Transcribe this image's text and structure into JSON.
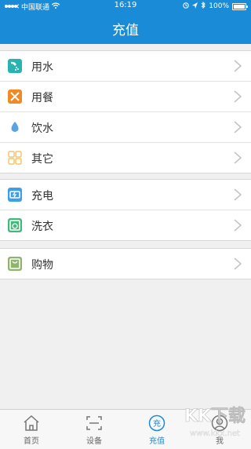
{
  "status": {
    "carrier": "中国联通",
    "time": "16:19",
    "battery": "100%"
  },
  "header": {
    "title": "充值"
  },
  "sections": [
    [
      {
        "label": "用水",
        "icon": "shower-icon",
        "color": "#27b3b0"
      },
      {
        "label": "用餐",
        "icon": "utensils-icon",
        "color": "#f08a24"
      },
      {
        "label": "饮水",
        "icon": "water-drop-icon",
        "color": "#5aa3e6"
      },
      {
        "label": "其它",
        "icon": "grid-icon",
        "color": "#f6c46a"
      }
    ],
    [
      {
        "label": "充电",
        "icon": "battery-charge-icon",
        "color": "#3f9ee8"
      },
      {
        "label": "洗衣",
        "icon": "washing-machine-icon",
        "color": "#44b87b"
      }
    ],
    [
      {
        "label": "购物",
        "icon": "shopping-bag-icon",
        "color": "#8fb56d"
      }
    ]
  ],
  "tabs": [
    {
      "label": "首页",
      "icon": "home-icon"
    },
    {
      "label": "设备",
      "icon": "scan-icon"
    },
    {
      "label": "充值",
      "icon": "recharge-icon",
      "active": true
    },
    {
      "label": "我",
      "icon": "user-icon"
    }
  ],
  "watermark": {
    "text": "KK下载",
    "url": "www.kkx.net"
  }
}
